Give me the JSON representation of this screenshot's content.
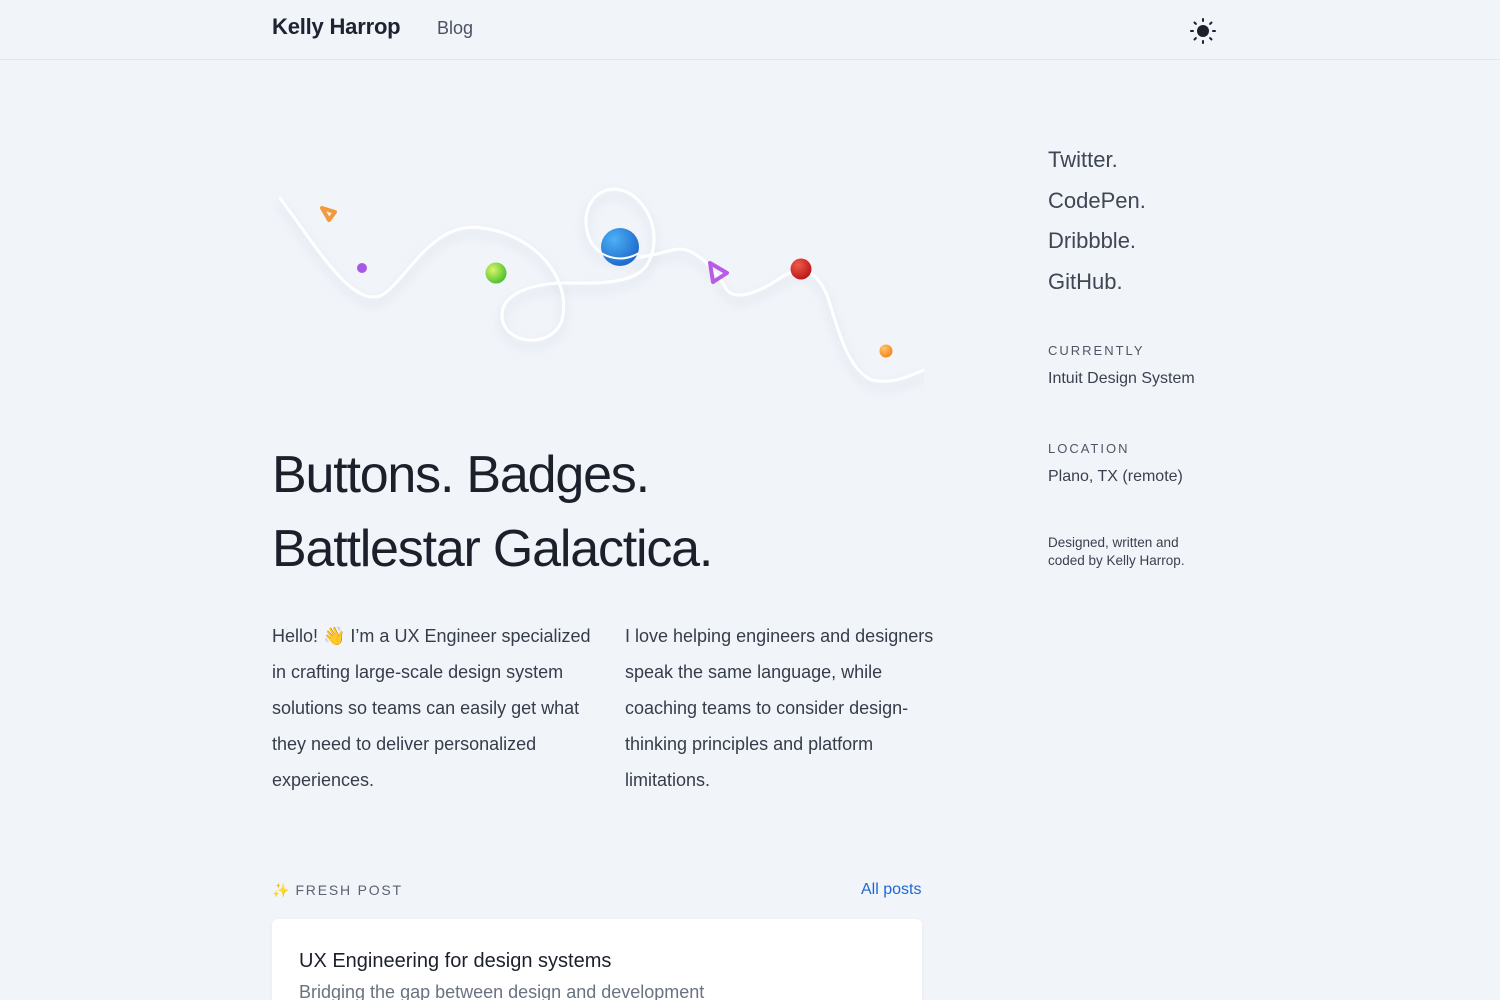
{
  "header": {
    "brand": "Kelly Harrop",
    "nav": [
      {
        "label": "Blog"
      }
    ],
    "theme_icon": "sun-icon"
  },
  "illustration": {
    "description_icons": [
      "orange-triangle-icon",
      "purple-dot-icon",
      "green-ball-icon",
      "blue-planet-icon",
      "purple-play-icon",
      "red-ball-icon",
      "orange-dot-icon"
    ]
  },
  "hero": {
    "line1": "Buttons. Badges.",
    "line2": "Battlestar Galactica."
  },
  "intro": {
    "left": "Hello! 👋  I’m a UX Engineer specialized in crafting large-scale design system solutions so teams can easily get what they need to deliver personalized experiences.",
    "right": "I love helping engineers and designers speak the same language, while coaching teams to consider design-thinking principles and platform limitations."
  },
  "fresh_post": {
    "label": "FRESH POST",
    "icon": "sparkles-icon",
    "all_posts": "All posts",
    "post": {
      "title": "UX Engineering for design systems",
      "subtitle": "Bridging the gap between design and development"
    }
  },
  "sidebar": {
    "social": [
      {
        "label": "Twitter."
      },
      {
        "label": "CodePen."
      },
      {
        "label": "Dribbble."
      },
      {
        "label": "GitHub."
      }
    ],
    "currently_label": "CURRENTLY",
    "currently_value": "Intuit Design System",
    "location_label": "LOCATION",
    "location_value": "Plano, TX (remote)",
    "credit": "Designed, written and coded by Kelly Harrop."
  },
  "colors": {
    "background": "#f1f4f9",
    "link": "#1f67d6",
    "text": "#1b202b"
  }
}
